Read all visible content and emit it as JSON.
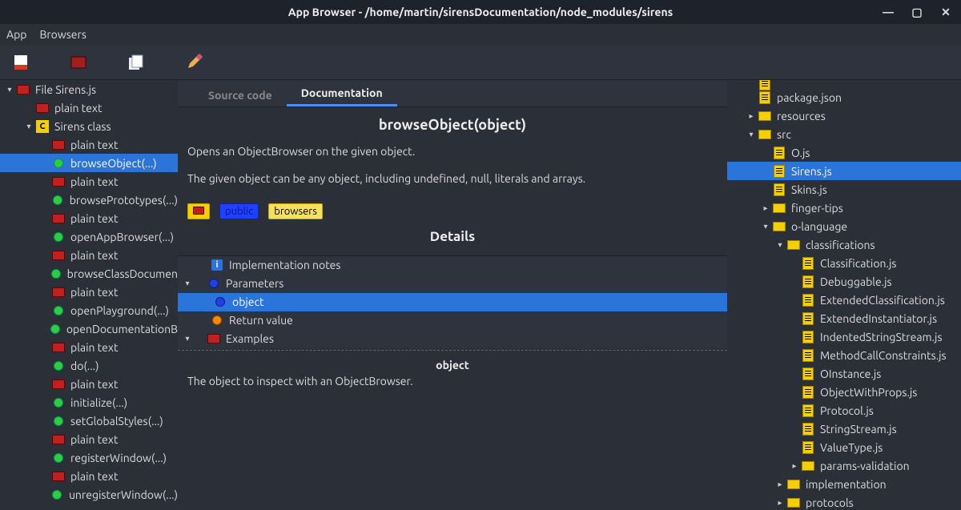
{
  "window": {
    "title": "App Browser - /home/martin/sirensDocumentation/node_modules/sirens"
  },
  "menu": {
    "app": "App",
    "browsers": "Browsers"
  },
  "tabs": {
    "source": "Source code",
    "documentation": "Documentation"
  },
  "doc": {
    "title": "browseObject(object)",
    "p1": "Opens an ObjectBrowser on the given object.",
    "p2": "The given object can be any object, including undefined, null, literals and arrays.",
    "tag_public": "public",
    "tag_browsers": "browsers"
  },
  "details": {
    "header": "Details",
    "impl": "Implementation notes",
    "params": "Parameters",
    "object": "object",
    "ret": "Return value",
    "examples": "Examples",
    "param_title": "object",
    "param_desc": "The object to inspect with an ObjectBrowser."
  },
  "left": [
    {
      "i": 0,
      "exp": "▾",
      "t": "File Sirens.js",
      "ico": "folder-red"
    },
    {
      "i": 1,
      "exp": "",
      "t": "plain text",
      "ico": "folder-red"
    },
    {
      "i": 1,
      "exp": "▾",
      "t": "Sirens class",
      "ico": "class"
    },
    {
      "i": 2,
      "exp": "",
      "t": "plain text",
      "ico": "folder-red"
    },
    {
      "i": 2,
      "exp": "",
      "t": "browseObject(...)",
      "ico": "method",
      "sel": true
    },
    {
      "i": 2,
      "exp": "",
      "t": "plain text",
      "ico": "folder-red"
    },
    {
      "i": 2,
      "exp": "",
      "t": "browsePrototypes(...)",
      "ico": "method"
    },
    {
      "i": 2,
      "exp": "",
      "t": "plain text",
      "ico": "folder-red"
    },
    {
      "i": 2,
      "exp": "",
      "t": "openAppBrowser(...)",
      "ico": "method"
    },
    {
      "i": 2,
      "exp": "",
      "t": "plain text",
      "ico": "folder-red"
    },
    {
      "i": 2,
      "exp": "",
      "t": "browseClassDocumen",
      "ico": "method"
    },
    {
      "i": 2,
      "exp": "",
      "t": "plain text",
      "ico": "folder-red"
    },
    {
      "i": 2,
      "exp": "",
      "t": "openPlayground(...)",
      "ico": "method"
    },
    {
      "i": 2,
      "exp": "",
      "t": "openDocumentationB",
      "ico": "method"
    },
    {
      "i": 2,
      "exp": "",
      "t": "plain text",
      "ico": "folder-red"
    },
    {
      "i": 2,
      "exp": "",
      "t": "do(...)",
      "ico": "method"
    },
    {
      "i": 2,
      "exp": "",
      "t": "plain text",
      "ico": "folder-red"
    },
    {
      "i": 2,
      "exp": "",
      "t": "initialize(...)",
      "ico": "method"
    },
    {
      "i": 2,
      "exp": "",
      "t": "setGlobalStyles(...)",
      "ico": "method"
    },
    {
      "i": 2,
      "exp": "",
      "t": "plain text",
      "ico": "folder-red"
    },
    {
      "i": 2,
      "exp": "",
      "t": "registerWindow(...)",
      "ico": "method"
    },
    {
      "i": 2,
      "exp": "",
      "t": "plain text",
      "ico": "folder-red"
    },
    {
      "i": 2,
      "exp": "",
      "t": "unregisterWindow(...)",
      "ico": "method"
    }
  ],
  "right": [
    {
      "i": 1,
      "exp": "",
      "t": "package.json",
      "ico": "file"
    },
    {
      "i": 1,
      "exp": "▸",
      "t": "resources",
      "ico": "folder"
    },
    {
      "i": 1,
      "exp": "▾",
      "t": "src",
      "ico": "folder"
    },
    {
      "i": 2,
      "exp": "",
      "t": "O.js",
      "ico": "file"
    },
    {
      "i": 2,
      "exp": "",
      "t": "Sirens.js",
      "ico": "file",
      "sel": true
    },
    {
      "i": 2,
      "exp": "",
      "t": "Skins.js",
      "ico": "file"
    },
    {
      "i": 2,
      "exp": "▸",
      "t": "finger-tips",
      "ico": "folder"
    },
    {
      "i": 2,
      "exp": "▾",
      "t": "o-language",
      "ico": "folder"
    },
    {
      "i": 3,
      "exp": "▾",
      "t": "classifications",
      "ico": "folder"
    },
    {
      "i": 4,
      "exp": "",
      "t": "Classification.js",
      "ico": "file"
    },
    {
      "i": 4,
      "exp": "",
      "t": "Debuggable.js",
      "ico": "file"
    },
    {
      "i": 4,
      "exp": "",
      "t": "ExtendedClassification.js",
      "ico": "file"
    },
    {
      "i": 4,
      "exp": "",
      "t": "ExtendedInstantiator.js",
      "ico": "file"
    },
    {
      "i": 4,
      "exp": "",
      "t": "IndentedStringStream.js",
      "ico": "file"
    },
    {
      "i": 4,
      "exp": "",
      "t": "MethodCallConstraints.js",
      "ico": "file"
    },
    {
      "i": 4,
      "exp": "",
      "t": "OInstance.js",
      "ico": "file"
    },
    {
      "i": 4,
      "exp": "",
      "t": "ObjectWithProps.js",
      "ico": "file"
    },
    {
      "i": 4,
      "exp": "",
      "t": "Protocol.js",
      "ico": "file"
    },
    {
      "i": 4,
      "exp": "",
      "t": "StringStream.js",
      "ico": "file"
    },
    {
      "i": 4,
      "exp": "",
      "t": "ValueType.js",
      "ico": "file"
    },
    {
      "i": 4,
      "exp": "▸",
      "t": "params-validation",
      "ico": "folder"
    },
    {
      "i": 3,
      "exp": "▸",
      "t": "implementation",
      "ico": "folder"
    },
    {
      "i": 3,
      "exp": "▸",
      "t": "protocols",
      "ico": "folder"
    }
  ]
}
